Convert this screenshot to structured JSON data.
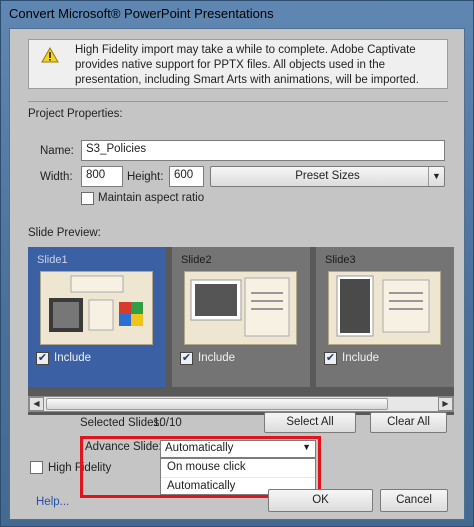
{
  "window": {
    "title": "Convert Microsoft® PowerPoint Presentations"
  },
  "notice": {
    "icon": "warning-icon",
    "text": "High Fidelity import may take a while to complete. Adobe Captivate provides native support for PPTX files. All objects used in the presentation, including Smart Arts with animations, will be imported."
  },
  "project": {
    "heading": "Project Properties:",
    "name_label": "Name:",
    "name_value": "S3_Policies",
    "width_label": "Width:",
    "width_value": "800",
    "height_label": "Height:",
    "height_value": "600",
    "preset_label": "Preset Sizes",
    "aspect_label": "Maintain aspect ratio",
    "aspect_checked": false
  },
  "preview": {
    "heading": "Slide Preview:",
    "slides": [
      {
        "title": "Slide1",
        "include_label": "Include",
        "included": true,
        "selected": true
      },
      {
        "title": "Slide2",
        "include_label": "Include",
        "included": true,
        "selected": false
      },
      {
        "title": "Slide3",
        "include_label": "Include",
        "included": true,
        "selected": false
      }
    ]
  },
  "selection": {
    "label": "Selected Slides:",
    "value": "10/10",
    "select_all": "Select All",
    "clear_all": "Clear All"
  },
  "advance": {
    "label": "Advance Slide:",
    "selected": "Automatically",
    "options": [
      "On mouse click",
      "Automatically"
    ]
  },
  "fidelity": {
    "label": "High Fidelity",
    "checked": false
  },
  "footer": {
    "help": "Help...",
    "ok": "OK",
    "cancel": "Cancel"
  },
  "colors": {
    "highlight": "#e0141a",
    "selected_slide": "#3b61a4",
    "link": "#2751a8"
  }
}
